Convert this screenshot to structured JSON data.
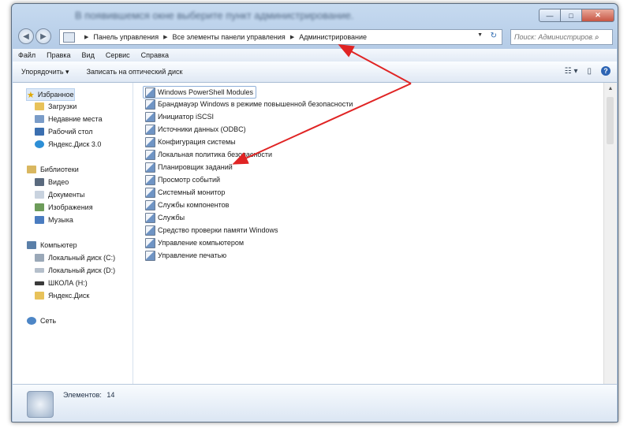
{
  "window": {
    "title": "В появившемся окне выберите пункт администрирование.",
    "controls": {
      "minimize": "—",
      "maximize": "□",
      "close": "✕"
    }
  },
  "nav_buttons": {
    "back": "◀",
    "forward": "▶"
  },
  "address": {
    "crumbs": [
      "Панель управления",
      "Все элементы панели управления",
      "Администрирование"
    ],
    "dropdown": "▼",
    "refresh": "↻"
  },
  "search": {
    "placeholder": "Поиск: Администриров...",
    "icon": "magnifier-icon"
  },
  "menu": [
    "Файл",
    "Правка",
    "Вид",
    "Сервис",
    "Справка"
  ],
  "toolbar": {
    "organize": "Упорядочить ▾",
    "burn": "Записать на оптический диск"
  },
  "sidebar": {
    "favorites": {
      "header": "Избранное",
      "items": [
        "Загрузки",
        "Недавние места",
        "Рабочий стол",
        "Яндекс.Диск 3.0"
      ]
    },
    "libraries": {
      "header": "Библиотеки",
      "items": [
        "Видео",
        "Документы",
        "Изображения",
        "Музыка"
      ]
    },
    "computer": {
      "header": "Компьютер",
      "items": [
        "Локальный диск (C:)",
        "Локальный диск (D:)",
        "ШКОЛА (H:)",
        "Яндекс.Диск"
      ]
    },
    "network": {
      "header": "Сеть"
    }
  },
  "files": [
    "Windows PowerShell Modules",
    "Брандмауэр Windows в режиме повышенной безопасности",
    "Инициатор iSCSI",
    "Источники данных (ODBC)",
    "Конфигурация системы",
    "Локальная политика безопасности",
    "Планировщик заданий",
    "Просмотр событий",
    "Системный монитор",
    "Службы компонентов",
    "Службы",
    "Средство проверки памяти Windows",
    "Управление компьютером",
    "Управление печатью"
  ],
  "status": {
    "label": "Элементов:",
    "count": "14"
  },
  "colors": {
    "annotation": "#e02424",
    "selection": "#dde9f7",
    "frame": "#b9cfe8"
  }
}
